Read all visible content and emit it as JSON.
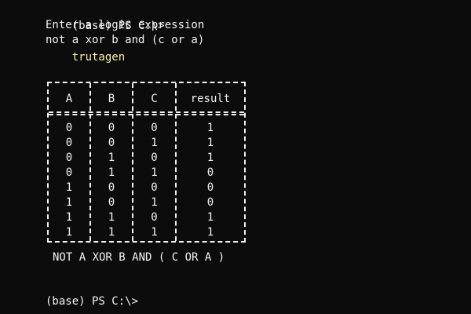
{
  "terminal": {
    "prompt": "(base) PS C:\\>",
    "command": "trutagen",
    "lines": [
      "Enter a logic expression",
      "not a xor b and (c or a)"
    ],
    "expression_caps": "NOT A XOR B AND ( C OR A )",
    "final_prompt": "(base) PS C:\\>"
  },
  "table": {
    "headers": [
      "A",
      "B",
      "C",
      "result"
    ],
    "rows": [
      [
        "0",
        "0",
        "0",
        "1"
      ],
      [
        "0",
        "0",
        "1",
        "1"
      ],
      [
        "0",
        "1",
        "0",
        "1"
      ],
      [
        "0",
        "1",
        "1",
        "0"
      ],
      [
        "1",
        "0",
        "0",
        "0"
      ],
      [
        "1",
        "0",
        "1",
        "0"
      ],
      [
        "1",
        "1",
        "0",
        "1"
      ],
      [
        "1",
        "1",
        "1",
        "1"
      ]
    ]
  },
  "colors": {
    "background": "#0c0c0c",
    "text": "#f2f2f2",
    "command": "#f9f1a5"
  }
}
